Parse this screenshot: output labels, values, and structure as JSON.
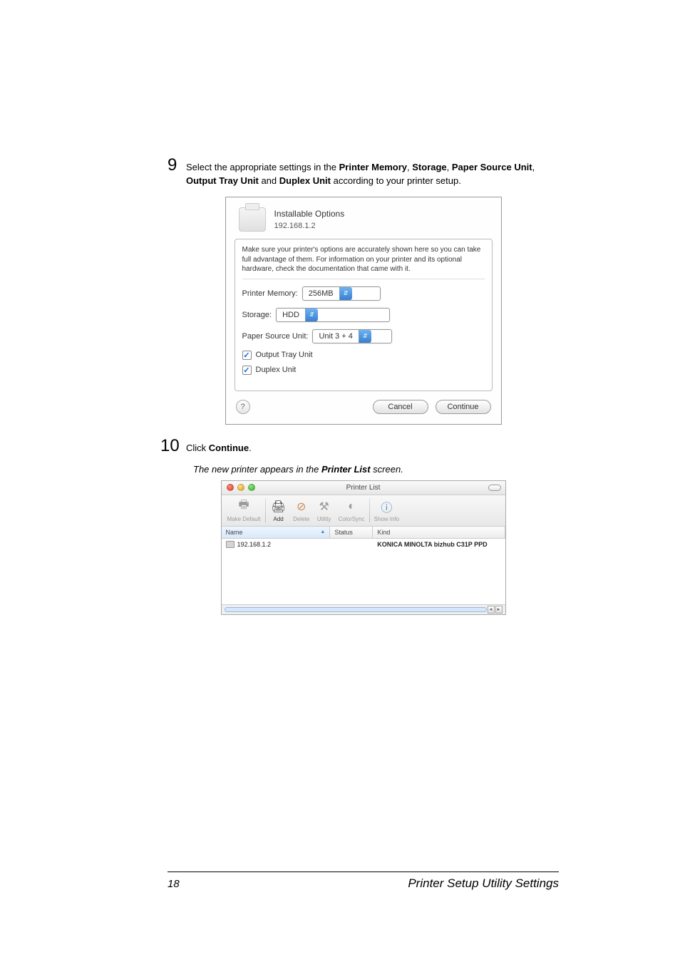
{
  "step9": {
    "num": "9",
    "text_prefix": "Select the appropriate settings in the ",
    "bold1": "Printer Memory",
    "sep1": ", ",
    "bold2": "Storage",
    "sep2": ", ",
    "bold3": "Paper Source Unit",
    "sep3": ", ",
    "bold4": "Output Tray Unit",
    "sep4": " and ",
    "bold5": "Duplex Unit",
    "text_suffix": " according to your printer setup."
  },
  "dialog": {
    "title": "Installable Options",
    "subtitle": "192.168.1.2",
    "message": "Make sure your printer's options are accurately shown here so you can take full advantage of them. For information on your printer and its optional hardware, check the documentation that came with it.",
    "mem_label": "Printer Memory:",
    "mem_value": "256MB",
    "storage_label": "Storage:",
    "storage_value": "HDD",
    "psu_label": "Paper Source Unit:",
    "psu_value": "Unit 3 + 4",
    "chk_output": "Output Tray Unit",
    "chk_duplex": "Duplex Unit",
    "help": "?",
    "cancel": "Cancel",
    "continue": "Continue"
  },
  "step10": {
    "num": "10",
    "text_prefix": "Click ",
    "bold1": "Continue",
    "text_suffix": "."
  },
  "result": {
    "prefix": "The new printer appears in the ",
    "bold": "Printer List",
    "suffix": " screen."
  },
  "plist": {
    "title": "Printer List",
    "toolbar": {
      "make_default": "Make Default",
      "add": "Add",
      "delete": "Delete",
      "utility": "Utility",
      "colorsync": "ColorSync",
      "showinfo": "Show Info"
    },
    "cols": {
      "name": "Name",
      "status": "Status",
      "kind": "Kind"
    },
    "row": {
      "name": "192.168.1.2",
      "kind": "KONICA MINOLTA bizhub C31P PPD"
    }
  },
  "footer": {
    "page": "18",
    "title": "Printer Setup Utility Settings"
  }
}
